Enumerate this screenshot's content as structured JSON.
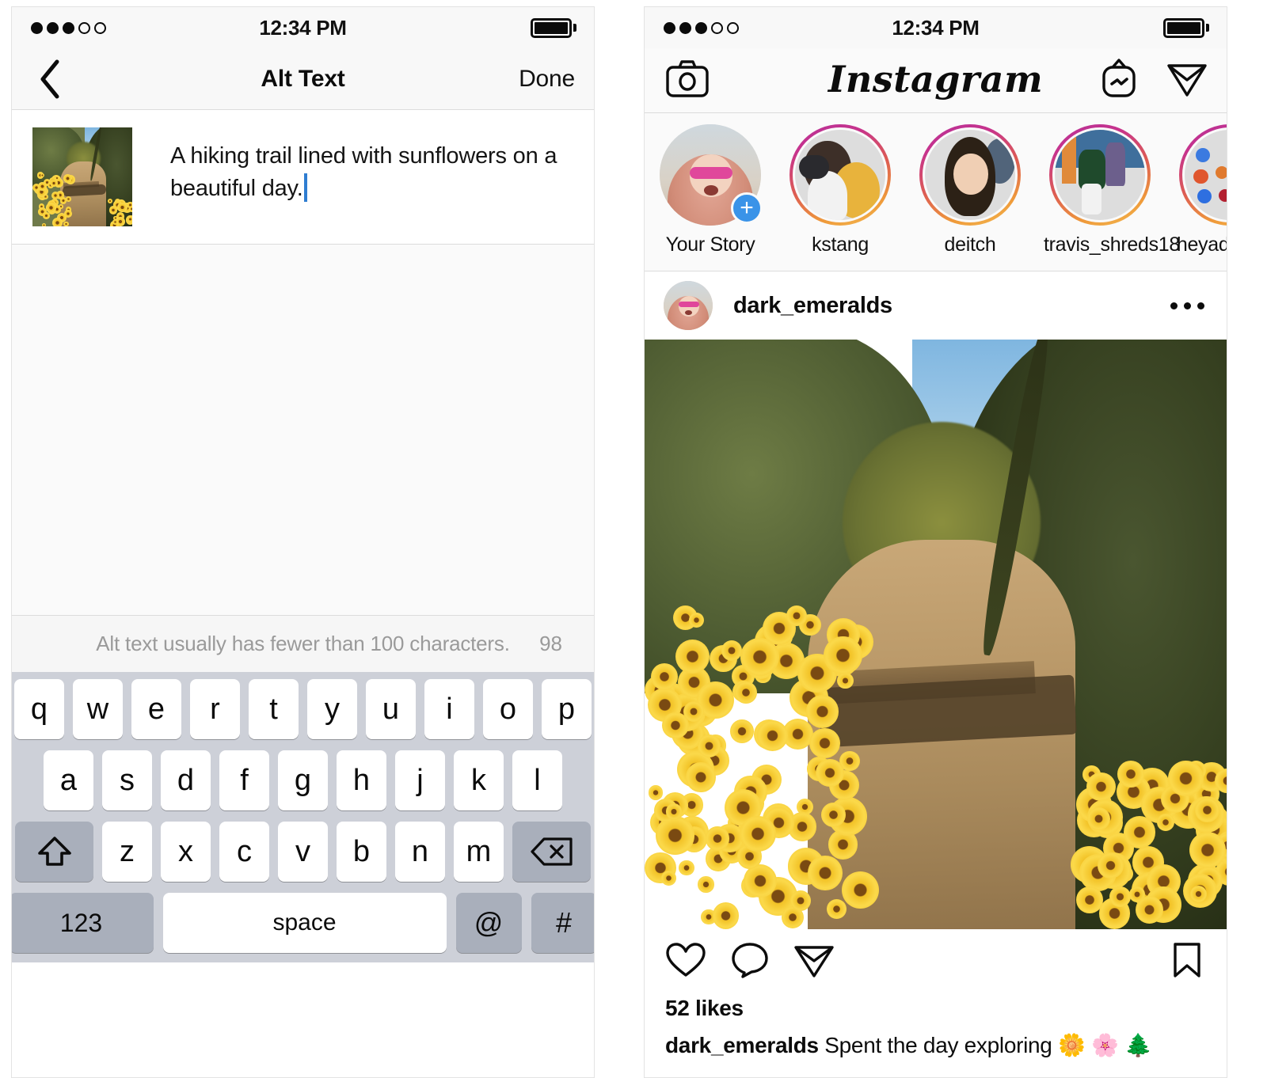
{
  "left_phone": {
    "status_bar": {
      "time": "12:34 PM",
      "signal_dots_filled": 3,
      "signal_dots_total": 5
    },
    "nav": {
      "back_icon": "chevron-left-icon",
      "title": "Alt Text",
      "done_label": "Done"
    },
    "editor": {
      "thumbnail_alt": "hiking trail with sunflowers thumbnail",
      "alt_text_value": "A hiking trail lined with sunflowers on a beautiful day.",
      "caret_color": "#2f7dd1"
    },
    "counter": {
      "hint": "Alt text usually has fewer than 100 characters.",
      "count": "98"
    },
    "keyboard": {
      "row1": [
        "q",
        "w",
        "e",
        "r",
        "t",
        "y",
        "u",
        "i",
        "o",
        "p"
      ],
      "row2": [
        "a",
        "s",
        "d",
        "f",
        "g",
        "h",
        "j",
        "k",
        "l"
      ],
      "row3_letters": [
        "z",
        "x",
        "c",
        "v",
        "b",
        "n",
        "m"
      ],
      "shift_icon": "shift-arrow-icon",
      "backspace_icon": "backspace-icon",
      "numbers_label": "123",
      "space_label": "space",
      "at_label": "@",
      "hash_label": "#"
    }
  },
  "right_phone": {
    "status_bar": {
      "time": "12:34 PM",
      "signal_dots_filled": 3,
      "signal_dots_total": 5
    },
    "header": {
      "camera_icon": "camera-icon",
      "logo_text": "Instagram",
      "igtv_icon": "igtv-icon",
      "direct_icon": "direct-message-icon"
    },
    "stories": [
      {
        "label": "Your Story",
        "has_ring": false,
        "has_plus": true
      },
      {
        "label": "kstang",
        "has_ring": true,
        "has_plus": false
      },
      {
        "label": "deitch",
        "has_ring": true,
        "has_plus": false
      },
      {
        "label": "travis_shreds18",
        "has_ring": true,
        "has_plus": false
      },
      {
        "label": "heyadrienne",
        "has_ring": true,
        "has_plus": false
      }
    ],
    "post": {
      "username": "dark_emeralds",
      "more_icon": "more-options-icon",
      "photo_alt": "A hiking trail lined with sunflowers on a beautiful day.",
      "actions": {
        "like_icon": "heart-icon",
        "comment_icon": "comment-bubble-icon",
        "share_icon": "share-paper-plane-icon",
        "save_icon": "bookmark-icon"
      },
      "likes_text": "52 likes",
      "caption_username": "dark_emeralds",
      "caption_text": " Spent the day exploring 🌼 🌸 🌲"
    }
  },
  "colors": {
    "keyboard_bg": "#cdd0d8",
    "key_white": "#ffffff",
    "key_grey": "#a9afbb",
    "story_ring_start": "#b5309a",
    "story_ring_end": "#f3bd55",
    "plus_badge": "#3a93e8",
    "hint_grey": "#9a9a9a"
  }
}
